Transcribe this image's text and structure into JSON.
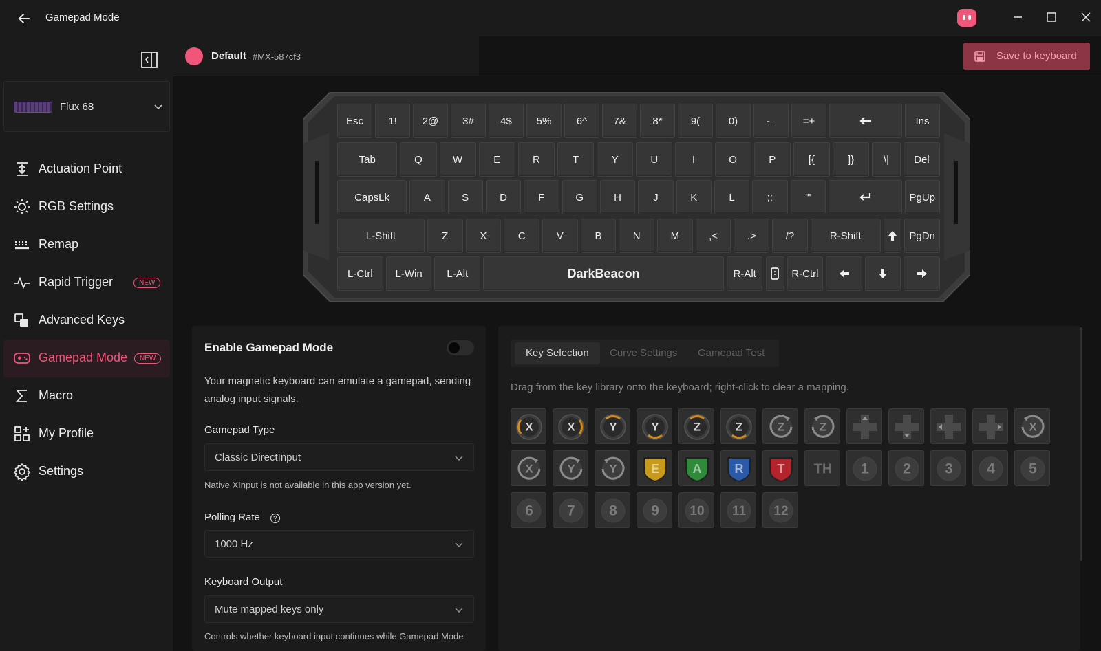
{
  "app": {
    "title": "Gamepad Mode"
  },
  "device": {
    "name": "Flux 68"
  },
  "nav": [
    {
      "label": "Actuation Point",
      "icon": "actuation-icon",
      "badge": ""
    },
    {
      "label": "RGB Settings",
      "icon": "sun-icon",
      "badge": ""
    },
    {
      "label": "Remap",
      "icon": "keyboard-grid-icon",
      "badge": ""
    },
    {
      "label": "Rapid Trigger",
      "icon": "pulse-icon",
      "badge": "NEW"
    },
    {
      "label": "Advanced Keys",
      "icon": "keys-stack-icon",
      "badge": ""
    },
    {
      "label": "Gamepad Mode",
      "icon": "gamepad-icon",
      "badge": "NEW",
      "active": true
    },
    {
      "label": "Macro",
      "icon": "sigma-icon",
      "badge": ""
    },
    {
      "label": "My Profile",
      "icon": "grid-plus-icon",
      "badge": ""
    },
    {
      "label": "Settings",
      "icon": "gear-icon",
      "badge": ""
    }
  ],
  "profile": {
    "name": "Default",
    "id": "#MX-587cf3"
  },
  "toolbar": {
    "save_label": "Save to keyboard"
  },
  "keyboard": {
    "brand": "DarkBeacon",
    "rows": [
      [
        "Esc",
        "1!",
        "2@",
        "3#",
        "4$",
        "5%",
        "6^",
        "7&",
        "8*",
        "9(",
        "0)",
        "-_",
        "=+",
        "Backspace",
        "Ins"
      ],
      [
        "Tab",
        "Q",
        "W",
        "E",
        "R",
        "T",
        "Y",
        "U",
        "I",
        "O",
        "P",
        "[{",
        "]}",
        "\\|",
        "Del"
      ],
      [
        "CapsLk",
        "A",
        "S",
        "D",
        "F",
        "G",
        "H",
        "J",
        "K",
        "L",
        ";:",
        "'\"",
        "Enter",
        "PgUp"
      ],
      [
        "L-Shift",
        "Z",
        "X",
        "C",
        "V",
        "B",
        "N",
        "M",
        ",<",
        ".>",
        "/?",
        "R-Shift",
        "Up",
        "PgDn"
      ],
      [
        "L-Ctrl",
        "L-Win",
        "L-Alt",
        "DarkBeacon",
        "R-Alt",
        "Fn",
        "R-Ctrl",
        "Left",
        "Down",
        "Right"
      ]
    ]
  },
  "gamepad": {
    "title": "Enable Gamepad Mode",
    "enabled": false,
    "description": "Your magnetic keyboard can emulate a gamepad, sending analog input signals.",
    "type_label": "Gamepad Type",
    "type_value": "Classic DirectInput",
    "type_hint": "Native XInput is not available in this app version yet.",
    "polling_label": "Polling Rate",
    "polling_value": "1000 Hz",
    "output_label": "Keyboard Output",
    "output_value": "Mute mapped keys only",
    "output_hint": "Controls whether keyboard input continues while Gamepad Mode"
  },
  "tabs": [
    "Key Selection",
    "Curve Settings",
    "Gamepad Test"
  ],
  "library_hint": "Drag from the key library onto the keyboard; right-click to clear a mapping.",
  "library": [
    {
      "label": "X",
      "kind": "stick-l"
    },
    {
      "label": "X",
      "kind": "stick-r"
    },
    {
      "label": "Y",
      "kind": "stick-u"
    },
    {
      "label": "Y",
      "kind": "stick-d"
    },
    {
      "label": "Z",
      "kind": "stick-u"
    },
    {
      "label": "Z",
      "kind": "stick-d"
    },
    {
      "label": "Z",
      "kind": "rot-r"
    },
    {
      "label": "Z",
      "kind": "rot-l"
    },
    {
      "label": "",
      "kind": "dpad-up"
    },
    {
      "label": "",
      "kind": "dpad-down"
    },
    {
      "label": "",
      "kind": "dpad-left"
    },
    {
      "label": "",
      "kind": "dpad-right"
    },
    {
      "label": "X",
      "kind": "rot-l"
    },
    {
      "label": "X",
      "kind": "rot-r"
    },
    {
      "label": "Y",
      "kind": "rot-r"
    },
    {
      "label": "Y",
      "kind": "rot-l"
    },
    {
      "label": "E",
      "kind": "shield",
      "color": "#c89a1c"
    },
    {
      "label": "A",
      "kind": "shield",
      "color": "#2f8a3a"
    },
    {
      "label": "R",
      "kind": "shield",
      "color": "#2b5aa8"
    },
    {
      "label": "T",
      "kind": "shield",
      "color": "#b3242d"
    },
    {
      "label": "TH",
      "kind": "plain"
    },
    {
      "label": "1",
      "kind": "circle"
    },
    {
      "label": "2",
      "kind": "circle"
    },
    {
      "label": "3",
      "kind": "circle"
    },
    {
      "label": "4",
      "kind": "circle"
    },
    {
      "label": "5",
      "kind": "circle"
    },
    {
      "label": "6",
      "kind": "circle"
    },
    {
      "label": "7",
      "kind": "circle"
    },
    {
      "label": "8",
      "kind": "circle"
    },
    {
      "label": "9",
      "kind": "circle"
    },
    {
      "label": "10",
      "kind": "circle"
    },
    {
      "label": "11",
      "kind": "circle"
    },
    {
      "label": "12",
      "kind": "circle"
    }
  ],
  "colors": {
    "accent": "#f0557a",
    "accent_dark": "#8c3544",
    "orange": "#d48a1c"
  }
}
